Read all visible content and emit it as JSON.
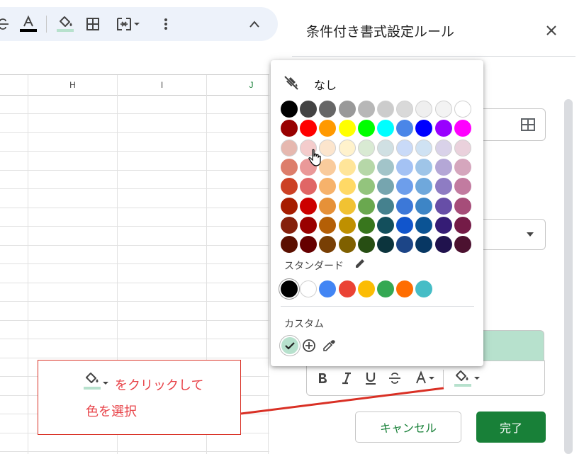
{
  "toolbar": {
    "icons": [
      "strikethrough-icon",
      "text-color-icon",
      "fill-color-icon",
      "borders-icon",
      "merge-cells-icon",
      "more-vert-icon",
      "collapse-icon"
    ],
    "text_color_underline": "#000000",
    "fill_color_underline": "#b7e1cd"
  },
  "grid": {
    "columns": [
      "H",
      "I",
      "J"
    ],
    "selected_column_color": "#188038"
  },
  "panel": {
    "title": "条件付き書式設定ルール",
    "cancel_label": "キャンセル",
    "done_label": "完了",
    "preview_color": "#b7e1cd",
    "accent": "#188038"
  },
  "color_picker": {
    "none_label": "なし",
    "standard_label": "スタンダード",
    "custom_label": "カスタム",
    "palette": [
      [
        "#000000",
        "#434343",
        "#666666",
        "#999999",
        "#b7b7b7",
        "#cccccc",
        "#d9d9d9",
        "#efefef",
        "#f3f3f3",
        "#ffffff"
      ],
      [
        "#980000",
        "#ff0000",
        "#ff9900",
        "#ffff00",
        "#00ff00",
        "#00ffff",
        "#4a86e8",
        "#0000ff",
        "#9900ff",
        "#ff00ff"
      ],
      [
        "#e6b8af",
        "#f4cccc",
        "#fce5cd",
        "#fff2cc",
        "#d9ead3",
        "#d0e0e3",
        "#c9daf8",
        "#cfe2f3",
        "#d9d2e9",
        "#ead1dc"
      ],
      [
        "#dd7e6b",
        "#ea9999",
        "#f9cb9c",
        "#ffe599",
        "#b6d7a8",
        "#a2c4c9",
        "#a4c2f4",
        "#9fc5e8",
        "#b4a7d6",
        "#d5a6bd"
      ],
      [
        "#cc4125",
        "#e06666",
        "#f6b26b",
        "#ffd966",
        "#93c47d",
        "#76a5af",
        "#6d9eeb",
        "#6fa8dc",
        "#8e7cc3",
        "#c27ba0"
      ],
      [
        "#a61c00",
        "#cc0000",
        "#e69138",
        "#f1c232",
        "#6aa84f",
        "#45818e",
        "#3c78d8",
        "#3d85c6",
        "#674ea7",
        "#a64d79"
      ],
      [
        "#85200c",
        "#990000",
        "#b45f06",
        "#bf9000",
        "#38761d",
        "#134f5c",
        "#1155cc",
        "#0b5394",
        "#351c75",
        "#741b47"
      ],
      [
        "#5b0f00",
        "#660000",
        "#783f04",
        "#7f6000",
        "#274e13",
        "#0c343d",
        "#1c4587",
        "#073763",
        "#20124d",
        "#4c1130"
      ]
    ],
    "standard": [
      "#000000",
      "#ffffff",
      "#4285f4",
      "#ea4335",
      "#fbbc04",
      "#34a853",
      "#ff6d01",
      "#46bdc6"
    ],
    "custom_selected": "#b7e1cd"
  },
  "annotation": {
    "line1": "をクリックして",
    "line2": "色を選択",
    "color": "#e8444a"
  }
}
